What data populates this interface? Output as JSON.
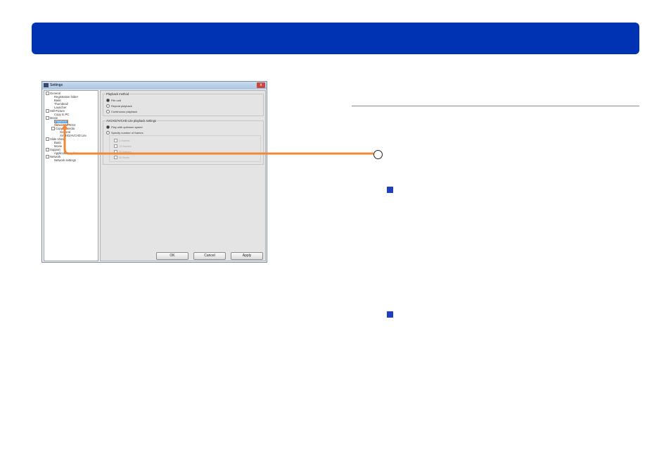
{
  "window": {
    "title": "Settings",
    "close_glyph": "x"
  },
  "tree": [
    {
      "label": "General",
      "expander": true
    },
    {
      "label": "Registration folder"
    },
    {
      "label": "Basic"
    },
    {
      "label": "Thumbnail"
    },
    {
      "label": "Launcher"
    },
    {
      "label": "Still Picture",
      "expander": true
    },
    {
      "label": "Copy to PC"
    },
    {
      "label": "Movie",
      "expander": true
    },
    {
      "label": "Playback",
      "selected": true
    },
    {
      "label": "Convert MPEG2"
    },
    {
      "label": "Copy to media",
      "expander": true
    },
    {
      "label": "General"
    },
    {
      "label": "AVCHD/AVCHD Lite"
    },
    {
      "label": "Slide show",
      "expander": true
    },
    {
      "label": "Basic"
    },
    {
      "label": "Movie"
    },
    {
      "label": "Support",
      "expander": true
    },
    {
      "label": "Application update"
    },
    {
      "label": "Network",
      "expander": true
    },
    {
      "label": "Network settings"
    }
  ],
  "playback_method": {
    "title": "Playback method",
    "options": [
      {
        "label": "File unit",
        "checked": true
      },
      {
        "label": "Repeat playback",
        "checked": false
      },
      {
        "label": "Continuous playback",
        "checked": false
      }
    ]
  },
  "avchd_settings": {
    "title": "AVCHD/AVCHD Lite playback settings",
    "options": [
      {
        "label": "Play with optimum speed",
        "checked": true
      },
      {
        "label": "Specify number of frames",
        "checked": false
      }
    ],
    "frames": [
      "5 frames",
      "15 frames",
      "30 frames",
      "60 fields"
    ]
  },
  "buttons": {
    "ok": "OK",
    "cancel": "Cancel",
    "apply": "Apply"
  },
  "colors": {
    "header_blue": "#0033b4",
    "accent_orange": "#f0883a",
    "bullet_blue": "#1f3fbf"
  }
}
